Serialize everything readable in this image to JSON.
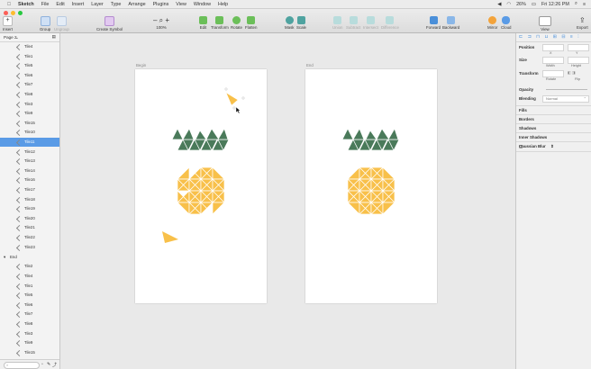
{
  "menubar": {
    "apple": "",
    "app_name": "Sketch",
    "items": [
      "File",
      "Edit",
      "Insert",
      "Layer",
      "Type",
      "Arrange",
      "Plugins",
      "View",
      "Window",
      "Help"
    ],
    "battery": "26%",
    "clock": "Fri 12:26 PM"
  },
  "toolbar": {
    "insert": "Insert",
    "group": "Group",
    "ungroup": "Ungroup",
    "create_symbol": "Create Symbol",
    "zoom": "100%",
    "edit": "Edit",
    "transform": "Transform",
    "rotate": "Rotate",
    "flatten": "Flatten",
    "mask": "Mask",
    "scale": "Scale",
    "union": "Union",
    "subtract": "Subtract",
    "intersect": "Intersect",
    "difference": "Difference",
    "forward": "Forward",
    "backward": "Backward",
    "mirror": "Mirror",
    "cloud": "Cloud",
    "view": "View",
    "export": "Export"
  },
  "layers": {
    "page": "Page 2",
    "rows": [
      {
        "label": "Tile4",
        "selected": false
      },
      {
        "label": "Tile1",
        "selected": false
      },
      {
        "label": "Tile5",
        "selected": false
      },
      {
        "label": "Tile6",
        "selected": false
      },
      {
        "label": "Tile7",
        "selected": false
      },
      {
        "label": "Tile8",
        "selected": false
      },
      {
        "label": "Tile3",
        "selected": false
      },
      {
        "label": "Tile9",
        "selected": false
      },
      {
        "label": "Tile15",
        "selected": false
      },
      {
        "label": "Tile10",
        "selected": false
      },
      {
        "label": "Tile11",
        "selected": true
      },
      {
        "label": "Tile12",
        "selected": false
      },
      {
        "label": "Tile13",
        "selected": false
      },
      {
        "label": "Tile14",
        "selected": false
      },
      {
        "label": "Tile16",
        "selected": false
      },
      {
        "label": "Tile17",
        "selected": false
      },
      {
        "label": "Tile18",
        "selected": false
      },
      {
        "label": "Tile19",
        "selected": false
      },
      {
        "label": "Tile20",
        "selected": false
      },
      {
        "label": "Tile21",
        "selected": false
      },
      {
        "label": "Tile22",
        "selected": false
      },
      {
        "label": "Tile23",
        "selected": false
      }
    ],
    "group_label": "End",
    "end_rows": [
      "Tile2",
      "Tile4",
      "Tile1",
      "Tile5",
      "Tile6",
      "Tile7",
      "Tile8",
      "Tile3",
      "Tile9",
      "Tile15"
    ]
  },
  "artboards": {
    "begin_label": "Begin",
    "end_label": "End"
  },
  "colors": {
    "leaf": "#4a7a5a",
    "fruit": "#f8c04a",
    "accent": "#5a9be6"
  },
  "inspector": {
    "position": "Position",
    "x": "X",
    "y": "Y",
    "size": "Size",
    "width": "Width",
    "height": "Height",
    "transform": "Transform",
    "rotate": "Rotate",
    "flip": "Flip",
    "opacity": "Opacity",
    "blending": "Blending",
    "blending_value": "Normal",
    "fills": "Fills",
    "borders": "Borders",
    "shadows": "Shadows",
    "inner_shadows": "Inner Shadows",
    "gaussian_blur": "Gaussian Blur"
  }
}
